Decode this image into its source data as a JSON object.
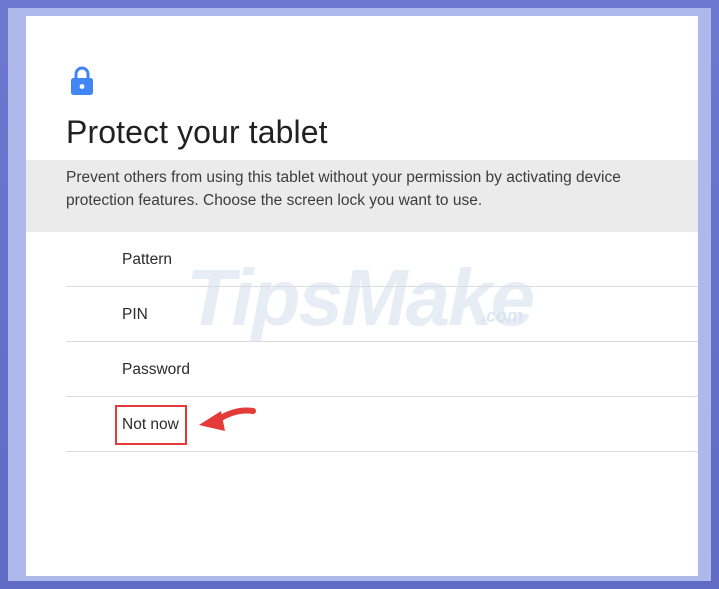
{
  "screen": {
    "title": "Protect your tablet",
    "description": "Prevent others from using this tablet without your permission by activating device protection features. Choose the screen lock you want to use.",
    "icon": "lock-icon",
    "options": [
      {
        "label": "Pattern"
      },
      {
        "label": "PIN"
      },
      {
        "label": "Password"
      },
      {
        "label": "Not now"
      }
    ]
  },
  "watermark": {
    "brand": "TipsMake",
    "suffix": ".com"
  },
  "colors": {
    "accent": "#4285f4",
    "highlight": "#e53a3a",
    "band": "#ebebeb",
    "frame": "#6b74c9"
  }
}
